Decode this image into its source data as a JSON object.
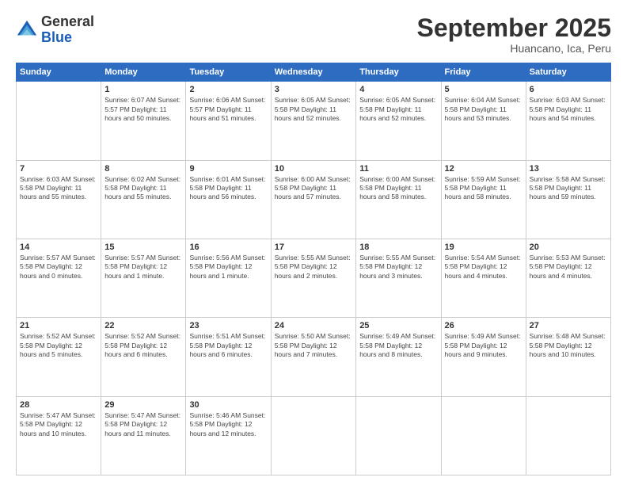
{
  "logo": {
    "general": "General",
    "blue": "Blue"
  },
  "header": {
    "month_year": "September 2025",
    "location": "Huancano, Ica, Peru"
  },
  "days_of_week": [
    "Sunday",
    "Monday",
    "Tuesday",
    "Wednesday",
    "Thursday",
    "Friday",
    "Saturday"
  ],
  "weeks": [
    [
      {
        "day": "",
        "info": ""
      },
      {
        "day": "1",
        "info": "Sunrise: 6:07 AM\nSunset: 5:57 PM\nDaylight: 11 hours\nand 50 minutes."
      },
      {
        "day": "2",
        "info": "Sunrise: 6:06 AM\nSunset: 5:57 PM\nDaylight: 11 hours\nand 51 minutes."
      },
      {
        "day": "3",
        "info": "Sunrise: 6:05 AM\nSunset: 5:58 PM\nDaylight: 11 hours\nand 52 minutes."
      },
      {
        "day": "4",
        "info": "Sunrise: 6:05 AM\nSunset: 5:58 PM\nDaylight: 11 hours\nand 52 minutes."
      },
      {
        "day": "5",
        "info": "Sunrise: 6:04 AM\nSunset: 5:58 PM\nDaylight: 11 hours\nand 53 minutes."
      },
      {
        "day": "6",
        "info": "Sunrise: 6:03 AM\nSunset: 5:58 PM\nDaylight: 11 hours\nand 54 minutes."
      }
    ],
    [
      {
        "day": "7",
        "info": "Sunrise: 6:03 AM\nSunset: 5:58 PM\nDaylight: 11 hours\nand 55 minutes."
      },
      {
        "day": "8",
        "info": "Sunrise: 6:02 AM\nSunset: 5:58 PM\nDaylight: 11 hours\nand 55 minutes."
      },
      {
        "day": "9",
        "info": "Sunrise: 6:01 AM\nSunset: 5:58 PM\nDaylight: 11 hours\nand 56 minutes."
      },
      {
        "day": "10",
        "info": "Sunrise: 6:00 AM\nSunset: 5:58 PM\nDaylight: 11 hours\nand 57 minutes."
      },
      {
        "day": "11",
        "info": "Sunrise: 6:00 AM\nSunset: 5:58 PM\nDaylight: 11 hours\nand 58 minutes."
      },
      {
        "day": "12",
        "info": "Sunrise: 5:59 AM\nSunset: 5:58 PM\nDaylight: 11 hours\nand 58 minutes."
      },
      {
        "day": "13",
        "info": "Sunrise: 5:58 AM\nSunset: 5:58 PM\nDaylight: 11 hours\nand 59 minutes."
      }
    ],
    [
      {
        "day": "14",
        "info": "Sunrise: 5:57 AM\nSunset: 5:58 PM\nDaylight: 12 hours\nand 0 minutes."
      },
      {
        "day": "15",
        "info": "Sunrise: 5:57 AM\nSunset: 5:58 PM\nDaylight: 12 hours\nand 1 minute."
      },
      {
        "day": "16",
        "info": "Sunrise: 5:56 AM\nSunset: 5:58 PM\nDaylight: 12 hours\nand 1 minute."
      },
      {
        "day": "17",
        "info": "Sunrise: 5:55 AM\nSunset: 5:58 PM\nDaylight: 12 hours\nand 2 minutes."
      },
      {
        "day": "18",
        "info": "Sunrise: 5:55 AM\nSunset: 5:58 PM\nDaylight: 12 hours\nand 3 minutes."
      },
      {
        "day": "19",
        "info": "Sunrise: 5:54 AM\nSunset: 5:58 PM\nDaylight: 12 hours\nand 4 minutes."
      },
      {
        "day": "20",
        "info": "Sunrise: 5:53 AM\nSunset: 5:58 PM\nDaylight: 12 hours\nand 4 minutes."
      }
    ],
    [
      {
        "day": "21",
        "info": "Sunrise: 5:52 AM\nSunset: 5:58 PM\nDaylight: 12 hours\nand 5 minutes."
      },
      {
        "day": "22",
        "info": "Sunrise: 5:52 AM\nSunset: 5:58 PM\nDaylight: 12 hours\nand 6 minutes."
      },
      {
        "day": "23",
        "info": "Sunrise: 5:51 AM\nSunset: 5:58 PM\nDaylight: 12 hours\nand 6 minutes."
      },
      {
        "day": "24",
        "info": "Sunrise: 5:50 AM\nSunset: 5:58 PM\nDaylight: 12 hours\nand 7 minutes."
      },
      {
        "day": "25",
        "info": "Sunrise: 5:49 AM\nSunset: 5:58 PM\nDaylight: 12 hours\nand 8 minutes."
      },
      {
        "day": "26",
        "info": "Sunrise: 5:49 AM\nSunset: 5:58 PM\nDaylight: 12 hours\nand 9 minutes."
      },
      {
        "day": "27",
        "info": "Sunrise: 5:48 AM\nSunset: 5:58 PM\nDaylight: 12 hours\nand 10 minutes."
      }
    ],
    [
      {
        "day": "28",
        "info": "Sunrise: 5:47 AM\nSunset: 5:58 PM\nDaylight: 12 hours\nand 10 minutes."
      },
      {
        "day": "29",
        "info": "Sunrise: 5:47 AM\nSunset: 5:58 PM\nDaylight: 12 hours\nand 11 minutes."
      },
      {
        "day": "30",
        "info": "Sunrise: 5:46 AM\nSunset: 5:58 PM\nDaylight: 12 hours\nand 12 minutes."
      },
      {
        "day": "",
        "info": ""
      },
      {
        "day": "",
        "info": ""
      },
      {
        "day": "",
        "info": ""
      },
      {
        "day": "",
        "info": ""
      }
    ]
  ]
}
